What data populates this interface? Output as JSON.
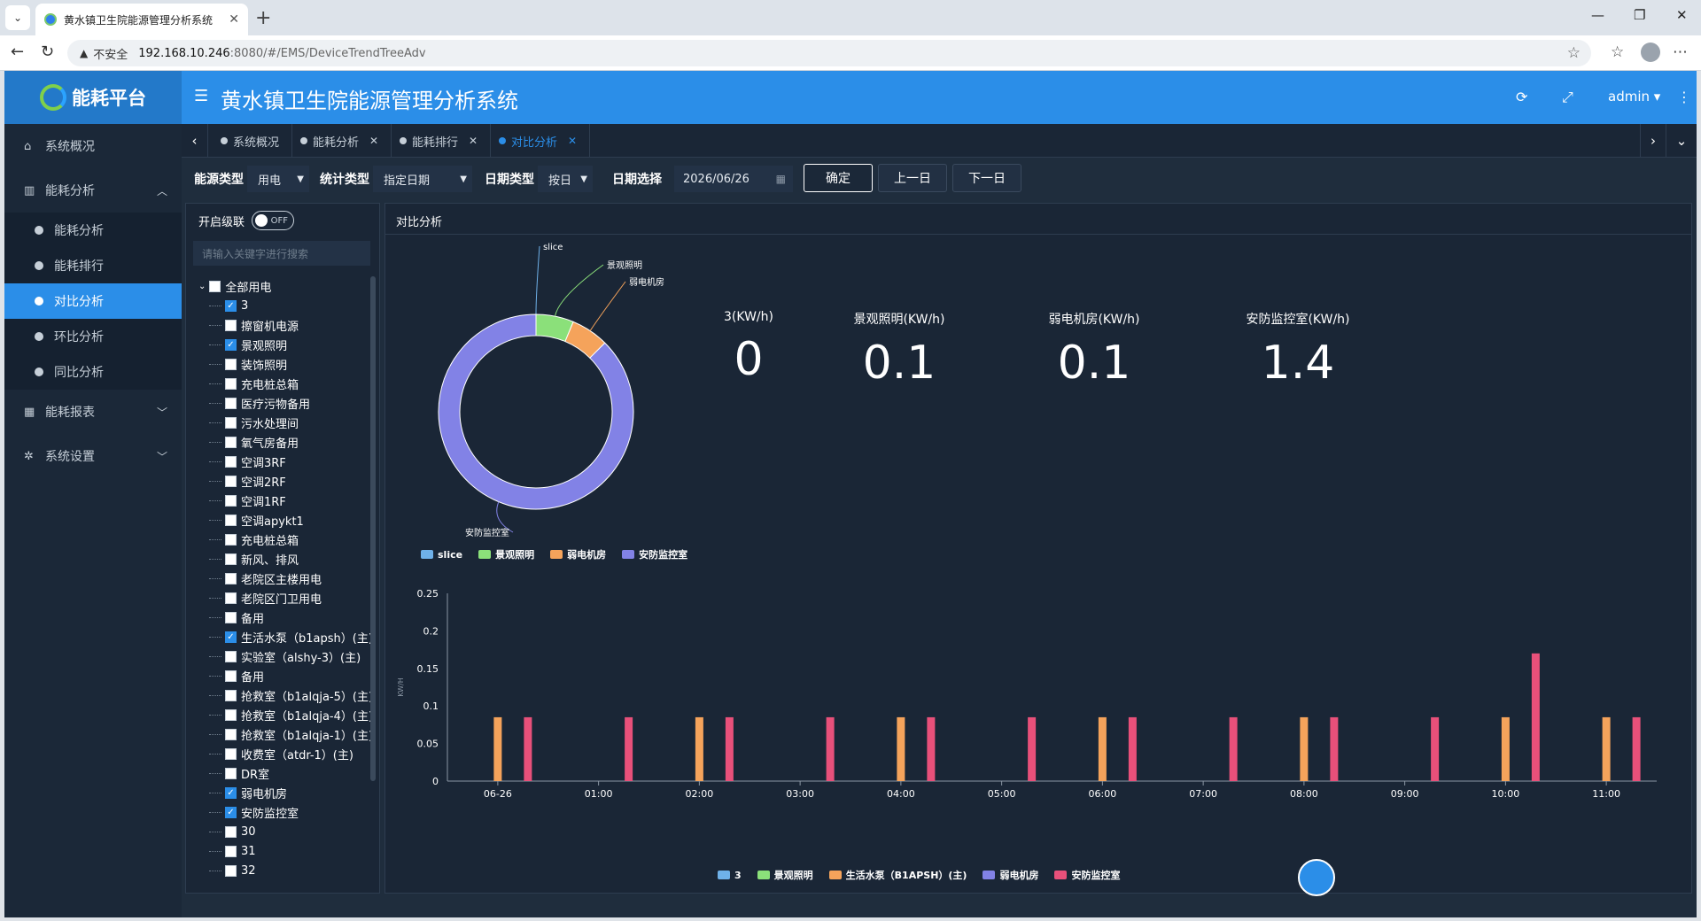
{
  "browser": {
    "tab_title": "黄水镇卫生院能源管理分析系统",
    "tab_close": "✕",
    "new_tab": "+",
    "insecure_label": "不安全",
    "url_host": "192.168.10.246",
    "url_rest": ":8080/#/EMS/DeviceTrendTreeAdv"
  },
  "app": {
    "logo_text": "能耗平台",
    "title": "黄水镇卫生院能源管理分析系统",
    "user": "admin"
  },
  "sidebar": {
    "items": [
      {
        "label": "系统概况"
      },
      {
        "label": "能耗分析"
      },
      {
        "label": "能耗报表"
      },
      {
        "label": "系统设置"
      }
    ],
    "subitems": [
      {
        "label": "能耗分析"
      },
      {
        "label": "能耗排行"
      },
      {
        "label": "对比分析"
      },
      {
        "label": "环比分析"
      },
      {
        "label": "同比分析"
      }
    ]
  },
  "page_tabs": [
    {
      "label": "系统概况"
    },
    {
      "label": "能耗分析"
    },
    {
      "label": "能耗排行"
    },
    {
      "label": "对比分析"
    }
  ],
  "filters": {
    "energy_type_label": "能源类型",
    "energy_type_value": "用电",
    "stat_type_label": "统计类型",
    "stat_type_value": "指定日期",
    "date_type_label": "日期类型",
    "date_type_value": "按日",
    "date_select_label": "日期选择",
    "date_value": "2026/06/26",
    "confirm": "确定",
    "prev": "上一日",
    "next": "下一日"
  },
  "tree": {
    "cascade_label": "开启级联",
    "toggle_text": "OFF",
    "search_placeholder": "请输入关键字进行搜索",
    "root": "全部用电",
    "nodes": [
      {
        "label": "3",
        "checked": true
      },
      {
        "label": "擦窗机电源",
        "checked": false
      },
      {
        "label": "景观照明",
        "checked": true
      },
      {
        "label": "装饰照明",
        "checked": false
      },
      {
        "label": "充电桩总箱",
        "checked": false
      },
      {
        "label": "医疗污物备用",
        "checked": false
      },
      {
        "label": "污水处理间",
        "checked": false
      },
      {
        "label": "氧气房备用",
        "checked": false
      },
      {
        "label": "空调3RF",
        "checked": false
      },
      {
        "label": "空调2RF",
        "checked": false
      },
      {
        "label": "空调1RF",
        "checked": false
      },
      {
        "label": "空调apykt1",
        "checked": false
      },
      {
        "label": "充电桩总箱",
        "checked": false
      },
      {
        "label": "新风、排风",
        "checked": false
      },
      {
        "label": "老院区主楼用电",
        "checked": false
      },
      {
        "label": "老院区门卫用电",
        "checked": false
      },
      {
        "label": "备用",
        "checked": false
      },
      {
        "label": "生活水泵（b1apsh）(主)",
        "checked": true
      },
      {
        "label": "实验室（alshy-3）(主)",
        "checked": false
      },
      {
        "label": "备用",
        "checked": false
      },
      {
        "label": "抢救室（b1alqja-5）(主)",
        "checked": false
      },
      {
        "label": "抢救室（b1alqja-4）(主)",
        "checked": false
      },
      {
        "label": "抢救室（b1alqja-1）(主)",
        "checked": false
      },
      {
        "label": "收费室（atdr-1）(主)",
        "checked": false
      },
      {
        "label": "DR室",
        "checked": false
      },
      {
        "label": "弱电机房",
        "checked": true
      },
      {
        "label": "安防监控室",
        "checked": true
      },
      {
        "label": "30",
        "checked": false
      },
      {
        "label": "31",
        "checked": false
      },
      {
        "label": "32",
        "checked": false
      }
    ]
  },
  "panel": {
    "title": "对比分析"
  },
  "stats": [
    {
      "label": "3(KW/h)",
      "value": "0"
    },
    {
      "label": "景观照明(KW/h)",
      "value": "0.1"
    },
    {
      "label": "弱电机房(KW/h)",
      "value": "0.1"
    },
    {
      "label": "安防监控室(KW/h)",
      "value": "1.4"
    }
  ],
  "colors": {
    "blue": "#6fb1e9",
    "green": "#8be07a",
    "orange": "#f5a35b",
    "purple": "#8282e6",
    "red": "#e8507a"
  },
  "chart_data": [
    {
      "type": "pie",
      "labels": [
        "slice",
        "景观照明",
        "弱电机房",
        "安防监控室"
      ],
      "values": [
        0.0,
        0.1,
        0.1,
        1.4
      ],
      "colors": [
        "#6fb1e9",
        "#8be07a",
        "#f5a35b",
        "#8282e6"
      ],
      "legend": [
        "slice",
        "景观照明",
        "弱电机房",
        "安防监控室"
      ],
      "donut": true
    },
    {
      "type": "bar",
      "ylabel": "KW/H",
      "ylim": [
        0,
        0.25
      ],
      "yticks": [
        "0",
        "0.05",
        "0.1",
        "0.15",
        "0.2",
        "0.25"
      ],
      "categories": [
        "06-26",
        "01:00",
        "02:00",
        "03:00",
        "04:00",
        "05:00",
        "06:00",
        "07:00",
        "08:00",
        "09:00",
        "10:00",
        "11:00"
      ],
      "series": [
        {
          "name": "3",
          "color": "#6fb1e9",
          "values": [
            0,
            0,
            0,
            0,
            0,
            0,
            0,
            0,
            0,
            0,
            0,
            0
          ]
        },
        {
          "name": "景观照明",
          "color": "#8be07a",
          "values": [
            0,
            0,
            0,
            0,
            0,
            0,
            0,
            0,
            0,
            0,
            0,
            0
          ]
        },
        {
          "name": "生活水泵（B1APSH）(主)",
          "color": "#f5a35b",
          "values": [
            0.085,
            0,
            0.085,
            0,
            0.085,
            0,
            0.085,
            0,
            0.085,
            0,
            0.085,
            0.085
          ]
        },
        {
          "name": "弱电机房",
          "color": "#8282e6",
          "values": [
            0,
            0,
            0,
            0,
            0,
            0,
            0,
            0,
            0,
            0,
            0,
            0
          ]
        },
        {
          "name": "安防监控室",
          "color": "#e8507a",
          "values": [
            0.085,
            0.085,
            0.085,
            0.085,
            0.085,
            0.085,
            0.085,
            0.085,
            0.085,
            0.085,
            0.17,
            0.085
          ]
        }
      ],
      "legend": [
        "3",
        "景观照明",
        "生活水泵（B1APSH）(主)",
        "弱电机房",
        "安防监控室"
      ]
    }
  ]
}
